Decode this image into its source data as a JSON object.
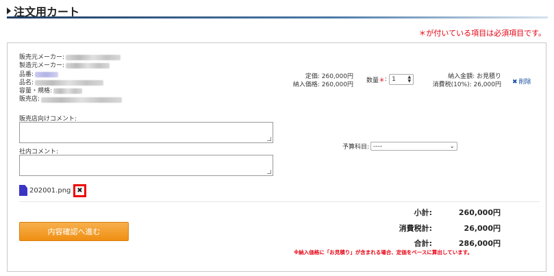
{
  "page": {
    "title": "注文用カート",
    "required_note": "＊が付いている項目は必須項目です。"
  },
  "item": {
    "fields": [
      {
        "label": "販売元メーカー:",
        "blur_w": 80,
        "blue": false
      },
      {
        "label": "製造元メーカー:",
        "blur_w": 64,
        "blue": false
      },
      {
        "label": "品番:",
        "blur_w": 34,
        "blue": true
      },
      {
        "label": "品名:",
        "blur_w": 100,
        "blue": false
      },
      {
        "label": "容量・規格:",
        "blur_w": 42,
        "blue": false
      },
      {
        "label": "販売店:",
        "blur_w": 118,
        "blue": false
      }
    ],
    "list_price": "定価: 260,000円",
    "purchase_price": "納入価格: 260,000円",
    "qty_label": "数量",
    "qty_required": "＊",
    "qty_colon": ":",
    "qty_value": "1",
    "delivery_amount": "納入金額: お見積り",
    "tax": "消費税(10%): 26,000円",
    "delete_label": "削除",
    "comment_seller_label": "販売店向けコメント:",
    "comment_internal_label": "社内コメント:",
    "budget_label": "予算科目:",
    "budget_value": "----",
    "attachment_name": "202001.png"
  },
  "summary": {
    "subtotal_label": "小計:",
    "subtotal_value": "260,000円",
    "tax_label": "消費税計:",
    "tax_value": "26,000円",
    "total_label": "合計:",
    "total_value": "286,000円"
  },
  "actions": {
    "proceed_label": "内容確認へ進む"
  },
  "footnote": "※納入価格に「お見積り」が含まれる場合、定価をベースに算出しています。"
}
